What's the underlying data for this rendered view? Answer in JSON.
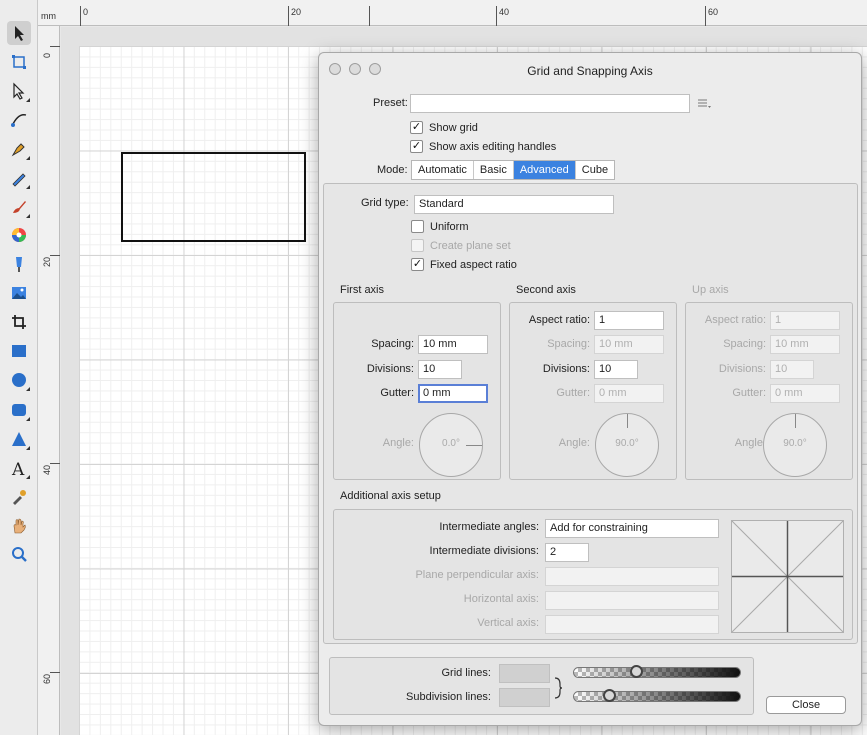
{
  "ruler": {
    "unit": "mm",
    "top_labels": [
      "0",
      "20",
      "40",
      "60"
    ],
    "left_labels": [
      "0",
      "20",
      "40",
      "60"
    ]
  },
  "toolbar": {
    "tools": [
      {
        "name": "move-tool",
        "icon": "arrow-icon",
        "active": true
      },
      {
        "name": "artboard-tool",
        "icon": "artboard-icon"
      },
      {
        "name": "node-tool",
        "icon": "node-arrow-icon"
      },
      {
        "name": "point-transform-tool",
        "icon": "point-transform-icon"
      },
      {
        "name": "pen-tool",
        "icon": "pen-icon"
      },
      {
        "name": "pencil-tool",
        "icon": "pencil-icon"
      },
      {
        "name": "vector-brush-tool",
        "icon": "brush-icon"
      },
      {
        "name": "fill-tool",
        "icon": "color-wheel-icon"
      },
      {
        "name": "transparency-tool",
        "icon": "transparency-icon"
      },
      {
        "name": "place-image-tool",
        "icon": "image-icon"
      },
      {
        "name": "crop-tool",
        "icon": "crop-icon"
      },
      {
        "name": "rectangle-tool",
        "icon": "rectangle-icon"
      },
      {
        "name": "ellipse-tool",
        "icon": "ellipse-icon"
      },
      {
        "name": "rounded-rectangle-tool",
        "icon": "rounded-rectangle-icon"
      },
      {
        "name": "triangle-tool",
        "icon": "triangle-icon"
      },
      {
        "name": "text-tool",
        "icon": "text-icon"
      },
      {
        "name": "color-picker-tool",
        "icon": "eyedropper-icon"
      },
      {
        "name": "view-tool",
        "icon": "hand-icon"
      },
      {
        "name": "zoom-tool",
        "icon": "magnifier-icon"
      }
    ]
  },
  "dialog": {
    "title": "Grid and Snapping Axis",
    "preset_label": "Preset:",
    "preset_value": "",
    "show_grid": {
      "label": "Show grid",
      "checked": true
    },
    "show_axis_handles": {
      "label": "Show axis editing handles",
      "checked": true
    },
    "mode_label": "Mode:",
    "modes": [
      "Automatic",
      "Basic",
      "Advanced",
      "Cube"
    ],
    "mode_selected": "Advanced",
    "grid_type_label": "Grid type:",
    "grid_type_value": "Standard",
    "uniform": {
      "label": "Uniform",
      "checked": false
    },
    "create_plane_set": {
      "label": "Create plane set",
      "checked": false
    },
    "fixed_aspect": {
      "label": "Fixed aspect ratio",
      "checked": true
    },
    "first_axis": {
      "title": "First axis",
      "spacing_label": "Spacing:",
      "spacing": "10 mm",
      "divisions_label": "Divisions:",
      "divisions": "10",
      "gutter_label": "Gutter:",
      "gutter": "0 mm",
      "angle_label": "Angle:",
      "angle": "0.0°"
    },
    "second_axis": {
      "title": "Second axis",
      "aspect_label": "Aspect ratio:",
      "aspect": "1",
      "spacing_label": "Spacing:",
      "spacing": "10 mm",
      "divisions_label": "Divisions:",
      "divisions": "10",
      "gutter_label": "Gutter:",
      "gutter": "0 mm",
      "angle_label": "Angle:",
      "angle": "90.0°"
    },
    "up_axis": {
      "title": "Up axis",
      "aspect_label": "Aspect ratio:",
      "aspect": "1",
      "spacing_label": "Spacing:",
      "spacing": "10 mm",
      "divisions_label": "Divisions:",
      "divisions": "10",
      "gutter_label": "Gutter:",
      "gutter": "0 mm",
      "angle_label": "Angle:",
      "angle": "90.0°"
    },
    "additional": {
      "title": "Additional axis setup",
      "intermediate_angles_label": "Intermediate angles:",
      "intermediate_angles": "Add for constraining",
      "intermediate_divisions_label": "Intermediate divisions:",
      "intermediate_divisions": "2",
      "plane_perp_label": "Plane perpendicular axis:",
      "horizontal_label": "Horizontal axis:",
      "vertical_label": "Vertical axis:"
    },
    "lines": {
      "grid_lines_label": "Grid lines:",
      "grid_lines_opacity": 0.36,
      "subdivision_lines_label": "Subdivision lines:",
      "subdivision_lines_opacity": 0.19
    },
    "close_label": "Close"
  },
  "colors": {
    "accent": "#3b82e0",
    "focus": "#5a7fd6"
  }
}
